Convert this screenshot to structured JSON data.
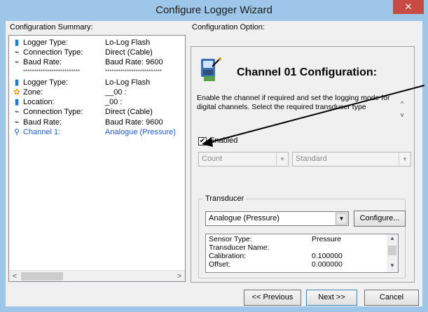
{
  "window": {
    "title": "Configure Logger Wizard",
    "close_glyph": "✕"
  },
  "summary": {
    "label": "Configuration Summary:",
    "rows": [
      {
        "icon": "usb-icon",
        "glyph": "▮",
        "key": "Logger Type:",
        "value": "Lo-Log Flash",
        "kind": "normal"
      },
      {
        "icon": "cable-icon",
        "glyph": "⌁",
        "key": "Connection Type:",
        "value": "Direct (Cable)",
        "kind": "normal"
      },
      {
        "icon": "cable-icon",
        "glyph": "⌁",
        "key": "Baud Rate:",
        "value": "Baud Rate: 9600",
        "kind": "normal"
      },
      {
        "icon": "",
        "glyph": "",
        "key": "**************************",
        "value": "**************************",
        "kind": "sep"
      },
      {
        "icon": "usb-icon",
        "glyph": "▮",
        "key": "Logger Type:",
        "value": "Lo-Log Flash",
        "kind": "normal"
      },
      {
        "icon": "zone-icon",
        "glyph": "✿",
        "key": "Zone:",
        "value": "__00 :",
        "kind": "normal"
      },
      {
        "icon": "usb-icon",
        "glyph": "▮",
        "key": "Location:",
        "value": "_00 :",
        "kind": "normal"
      },
      {
        "icon": "cable-icon",
        "glyph": "⌁",
        "key": "Connection Type:",
        "value": "Direct (Cable)",
        "kind": "normal"
      },
      {
        "icon": "cable-icon",
        "glyph": "⌁",
        "key": "Baud Rate:",
        "value": "Baud Rate: 9600",
        "kind": "normal"
      },
      {
        "icon": "channel-icon",
        "glyph": "⚲",
        "key": "Channel 1:",
        "value": "Analogue (Pressure)",
        "kind": "hl"
      }
    ],
    "scroll_left": "<",
    "scroll_right": ">"
  },
  "options": {
    "label": "Configuration Option:",
    "title": "Channel 01 Configuration:",
    "description": "Enable the channel if required and set the logging mode for digital channels. Select the required transducer type",
    "desc_up": "^",
    "desc_down": "v",
    "enabled_checked": true,
    "enabled_label": "Enabled",
    "mode_value": "Count",
    "type_value": "Standard",
    "transducer": {
      "group_label": "Transducer",
      "value": "Analogue (Pressure)",
      "configure_label": "Configure...",
      "details": [
        {
          "key": "Sensor Type:",
          "value": "Pressure"
        },
        {
          "key": "Transducer Name:",
          "value": ""
        },
        {
          "key": "Calibration:",
          "value": "0.100000"
        },
        {
          "key": "Offset:",
          "value": "0.000000"
        }
      ]
    }
  },
  "buttons": {
    "previous": "<< Previous",
    "next": "Next >>",
    "cancel": "Cancel"
  },
  "colors": {
    "titlebar": "#9ec6e8",
    "close": "#c74b42",
    "highlight_text": "#1c5cc8"
  }
}
